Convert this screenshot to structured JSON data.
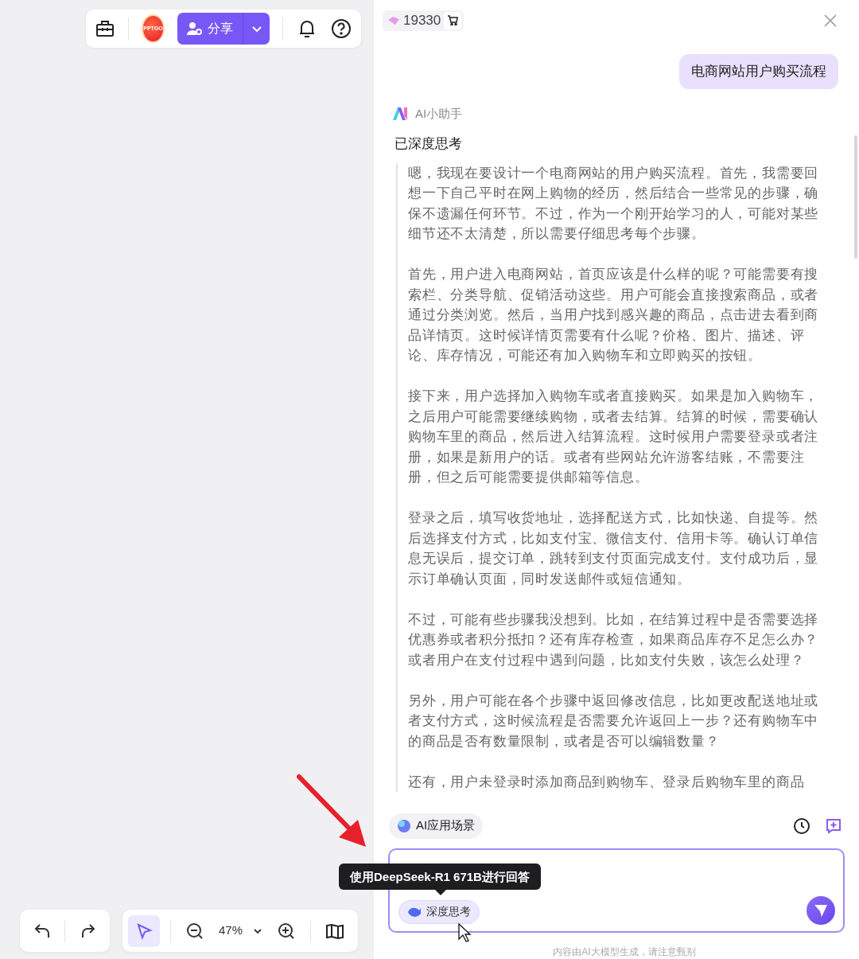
{
  "top_toolbar": {
    "avatar_text": "PPTGO",
    "share_label": "分享"
  },
  "credits": {
    "amount": "19330"
  },
  "user_message": {
    "text": "电商网站用户购买流程"
  },
  "assistant": {
    "name": "AI小助手",
    "thinking_label": "已深度思考",
    "thinking_paragraphs": [
      "嗯，我现在要设计一个电商网站的用户购买流程。首先，我需要回想一下自己平时在网上购物的经历，然后结合一些常见的步骤，确保不遗漏任何环节。不过，作为一个刚开始学习的人，可能对某些细节还不太清楚，所以需要仔细思考每个步骤。",
      "首先，用户进入电商网站，首页应该是什么样的呢？可能需要有搜索栏、分类导航、促销活动这些。用户可能会直接搜索商品，或者通过分类浏览。然后，当用户找到感兴趣的商品，点击进去看到商品详情页。这时候详情页需要有什么呢？价格、图片、描述、评论、库存情况，可能还有加入购物车和立即购买的按钮。",
      "接下来，用户选择加入购物车或者直接购买。如果是加入购物车，之后用户可能需要继续购物，或者去结算。结算的时候，需要确认购物车里的商品，然后进入结算流程。这时候用户需要登录或者注册，如果是新用户的话。或者有些网站允许游客结账，不需要注册，但之后可能需要提供邮箱等信息。",
      "登录之后，填写收货地址，选择配送方式，比如快递、自提等。然后选择支付方式，比如支付宝、微信支付、信用卡等。确认订单信息无误后，提交订单，跳转到支付页面完成支付。支付成功后，显示订单确认页面，同时发送邮件或短信通知。",
      "不过，可能有些步骤我没想到。比如，在结算过程中是否需要选择优惠券或者积分抵扣？还有库存检查，如果商品库存不足怎么办？或者用户在支付过程中遇到问题，比如支付失败，该怎么处理？",
      "另外，用户可能在各个步骤中返回修改信息，比如更改配送地址或者支付方式，这时候流程是否需要允许返回上一步？还有购物车中的商品是否有数量限制，或者是否可以编辑数量？",
      "还有，用户未登录时添加商品到购物车、登录后购物车里的商品"
    ]
  },
  "scenario_chip": {
    "label": "AI应用场景"
  },
  "composer": {
    "deep_think": {
      "label": "深度思考",
      "selected": true
    },
    "tooltip": "使用DeepSeek-R1 671B进行回答"
  },
  "disclaimer": "内容由AI大模型生成，请注意甄别",
  "bottom_toolbar": {
    "select_tool": {
      "selected": true
    },
    "zoom_level": "47%"
  }
}
